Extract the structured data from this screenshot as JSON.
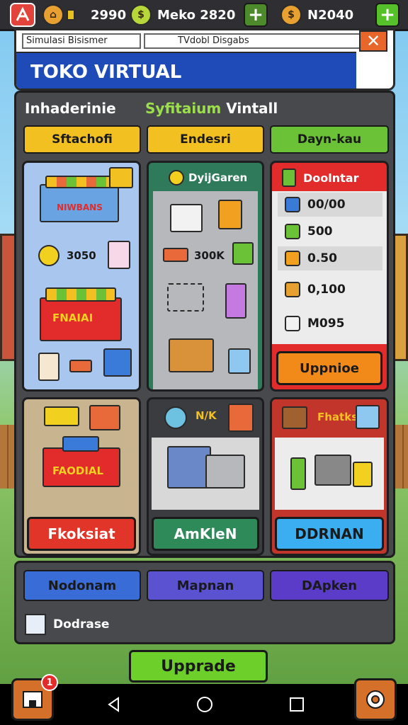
{
  "status_bar": {
    "resource_1": "2990",
    "resource_2": "Meko 2820",
    "resource_3": "N2040",
    "plus_symbol": "+"
  },
  "header": {
    "input_text": "Simulasi Bisismer",
    "tab_text": "TVdobl Disgabs",
    "title": "TOKO VIRTUAL",
    "close_symbol": "✕"
  },
  "panel": {
    "heading_left": "Inhaderinie",
    "heading_right_green": "Syfitaium",
    "heading_right_white": "Vintall",
    "categories": [
      "Sftachofi",
      "Endesri",
      "Dayn-kau"
    ]
  },
  "cards": {
    "card1": {
      "banner": "NIWBANS",
      "price": "3050",
      "sign": "FNAIAI"
    },
    "card2": {
      "header": "DyijGaren",
      "price": "300K"
    },
    "card3": {
      "header": "Doolntar",
      "rows": [
        "00/00",
        "500",
        "0.50",
        "0,100",
        "M095"
      ],
      "button": "Uppnioe"
    },
    "card4": {
      "sign": "FAODIAL",
      "button": "Fkoksiat"
    },
    "card5": {
      "label": "N/K",
      "button": "AmKleN"
    },
    "card6": {
      "label": "Fhatks",
      "button": "DDRNAN"
    }
  },
  "bottom": {
    "buttons": [
      "Nodonam",
      "Mapnan",
      "DApken"
    ],
    "row_label": "Dodrase"
  },
  "upgrade_label": "Upprade",
  "notification_count": "1",
  "colors": {
    "accent_blue": "#1e4bb8",
    "upgrade_green": "#6ccf2a",
    "danger_red": "#e2433a",
    "panel_gray": "#48494d"
  }
}
